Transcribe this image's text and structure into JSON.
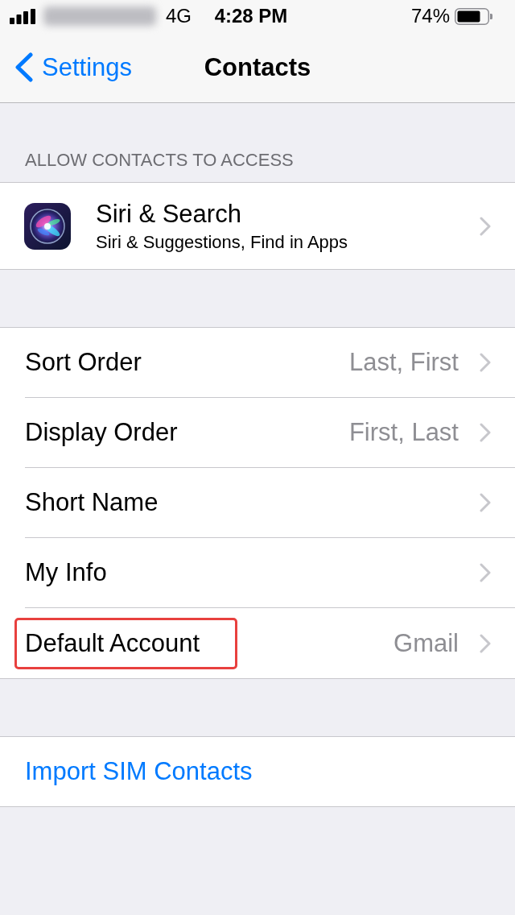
{
  "status_bar": {
    "network": "4G",
    "time": "4:28 PM",
    "battery_percent": "74%"
  },
  "nav_bar": {
    "back_label": "Settings",
    "title": "Contacts"
  },
  "sections": [
    {
      "header": "ALLOW CONTACTS TO ACCESS",
      "rows": [
        {
          "kind": "app",
          "title": "Siri & Search",
          "subtitle": "Siri & Suggestions, Find in Apps",
          "highlighted": false
        }
      ]
    },
    {
      "rows": [
        {
          "kind": "setting",
          "title": "Sort Order",
          "value": "Last, First",
          "highlighted": false
        },
        {
          "kind": "setting",
          "title": "Display Order",
          "value": "First, Last",
          "highlighted": false
        },
        {
          "kind": "setting",
          "title": "Short Name",
          "highlighted": false
        },
        {
          "kind": "setting",
          "title": "My Info",
          "highlighted": false
        },
        {
          "kind": "setting",
          "title": "Default Account",
          "value": "Gmail",
          "highlighted": true
        }
      ]
    },
    {
      "rows": [
        {
          "kind": "action",
          "title": "Import SIM Contacts",
          "highlighted": false
        }
      ]
    }
  ]
}
